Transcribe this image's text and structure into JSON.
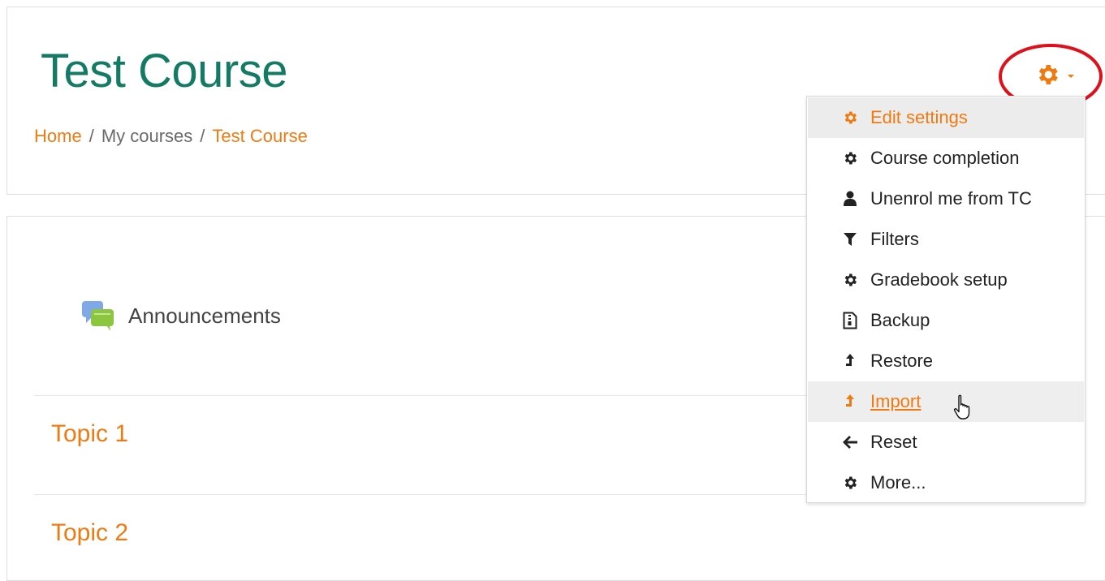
{
  "course": {
    "title": "Test Course",
    "breadcrumb": [
      {
        "label": "Home",
        "link": true
      },
      {
        "label": "My courses",
        "link": false
      },
      {
        "label": "Test Course",
        "link": true
      }
    ],
    "separator": "/"
  },
  "content": {
    "announcements_label": "Announcements",
    "topics": [
      "Topic 1",
      "Topic 2"
    ]
  },
  "settings_menu": {
    "toggle_icon": "gear-icon",
    "items": [
      {
        "label": "Edit settings",
        "icon": "gear-icon",
        "state": "active"
      },
      {
        "label": "Course completion",
        "icon": "gear-icon",
        "state": "normal"
      },
      {
        "label": "Unenrol me from TC",
        "icon": "user-icon",
        "state": "normal"
      },
      {
        "label": "Filters",
        "icon": "filter-icon",
        "state": "normal"
      },
      {
        "label": "Gradebook setup",
        "icon": "gear-icon",
        "state": "normal"
      },
      {
        "label": "Backup",
        "icon": "file-archive-icon",
        "state": "normal"
      },
      {
        "label": "Restore",
        "icon": "level-up-icon",
        "state": "normal"
      },
      {
        "label": "Import",
        "icon": "level-up-icon",
        "state": "hover"
      },
      {
        "label": "Reset",
        "icon": "arrow-left-icon",
        "state": "normal"
      },
      {
        "label": "More...",
        "icon": "gear-icon",
        "state": "normal"
      }
    ]
  },
  "colors": {
    "accent": "#f07a12",
    "title": "#137a63",
    "highlight_ring": "#e0101a"
  }
}
